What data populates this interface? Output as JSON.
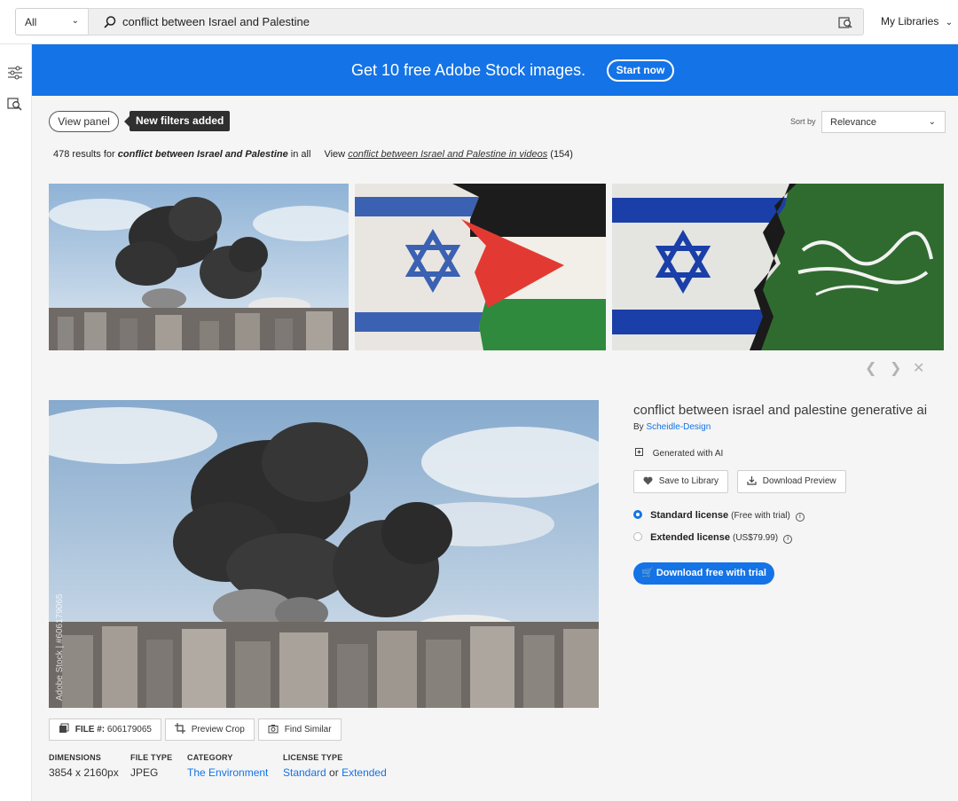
{
  "search": {
    "scope": "All",
    "query": "conflict between Israel and Palestine",
    "my_libraries": "My Libraries"
  },
  "promo": {
    "text": "Get 10 free Adobe Stock images.",
    "button": "Start now"
  },
  "controls": {
    "view_panel": "View panel",
    "tooltip": "New filters added",
    "sort_by_label": "Sort by",
    "sort_value": "Relevance"
  },
  "results": {
    "count_text": "478 results for",
    "query": "conflict between Israel and Palestine",
    "in_all": "in all",
    "view_label": "View",
    "video_link": "conflict between Israel and Palestine in videos",
    "video_count": "(154)"
  },
  "thumbnails": [
    {
      "subject": "smoke-over-city"
    },
    {
      "subject": "israel-palestine-flags"
    },
    {
      "subject": "israel-hamas-flags"
    }
  ],
  "detail": {
    "title": "conflict between israel and palestine generative ai",
    "by_label": "By",
    "author": "Scheidle-Design",
    "generated_ai": "Generated with AI",
    "save_to_library": "Save to Library",
    "download_preview": "Download Preview",
    "standard_license": "Standard license",
    "standard_note": "(Free with trial)",
    "extended_license": "Extended license",
    "extended_price": "(US$79.99)",
    "download_button": "Download free with trial",
    "watermark": "Adobe Stock | #606179065"
  },
  "file_info": {
    "file_label": "FILE #:",
    "file_number": "606179065",
    "preview_crop": "Preview Crop",
    "find_similar": "Find Similar",
    "dimensions_label": "DIMENSIONS",
    "dimensions_value": "3854 x 2160px",
    "file_type_label": "FILE TYPE",
    "file_type_value": "JPEG",
    "category_label": "CATEGORY",
    "category_value": "The Environment",
    "license_type_label": "LICENSE TYPE",
    "license_standard": "Standard",
    "license_or": "or",
    "license_extended": "Extended"
  },
  "colors": {
    "accent": "#1473e6",
    "tooltip_bg": "#2f2f2f"
  }
}
